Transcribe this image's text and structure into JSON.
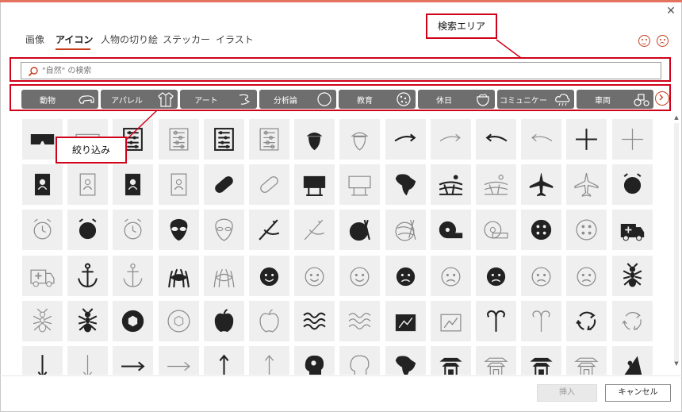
{
  "tabs": [
    {
      "label": "画像",
      "active": false
    },
    {
      "label": "アイコン",
      "active": true
    },
    {
      "label": "人物の切り絵",
      "active": false
    },
    {
      "label": "ステッカー",
      "active": false
    },
    {
      "label": "イラスト",
      "active": false
    }
  ],
  "search": {
    "placeholder": "\"自然\" の検索",
    "value": ""
  },
  "filters": [
    {
      "label": "動物",
      "icon": "bison-icon"
    },
    {
      "label": "アパレル",
      "icon": "jacket-icon"
    },
    {
      "label": "アート",
      "icon": "swirl-icon"
    },
    {
      "label": "分析論",
      "icon": "circle-icon"
    },
    {
      "label": "教育",
      "icon": "cookie-icon"
    },
    {
      "label": "休日",
      "icon": "cauldron-icon"
    },
    {
      "label": "コミュニケー",
      "icon": "cloud-icon"
    },
    {
      "label": "車両",
      "icon": "tractor-icon"
    }
  ],
  "callouts": {
    "search_area": "検索エリア",
    "filter": "絞り込み"
  },
  "icon_rows": [
    [
      "3d-glasses-icon",
      "3d-glasses-outline-icon",
      "abacus-icon",
      "abacus-outline-icon",
      "abacus-icon",
      "abacus-outline-icon",
      "acorn-icon",
      "acorn-outline-icon",
      "arrow-turn-right-icon",
      "arrow-turn-right-outline-icon",
      "arrow-turn-left-icon",
      "arrow-turn-left-outline-icon",
      "plus-icon",
      "plus-outline-icon"
    ],
    [
      "address-book-icon",
      "address-book-outline-icon",
      "address-book-icon",
      "address-book-outline-icon",
      "bandage-icon",
      "bandage-outline-icon",
      "billboard-icon",
      "billboard-outline-icon",
      "africa-icon",
      "farm-landscape-icon",
      "farm-landscape-outline-icon",
      "airplane-icon",
      "airplane-outline-icon",
      "alarm-clock-icon"
    ],
    [
      "alarm-clock-outline-icon",
      "alarm-ringing-icon",
      "alarm-ringing-outline-icon",
      "alien-icon",
      "alien-outline-icon",
      "needle-icon",
      "needle-outline-icon",
      "yarn-icon",
      "yarn-outline-icon",
      "measuring-tape-icon",
      "measuring-tape-outline-icon",
      "button-icon",
      "button-outline-icon",
      "ambulance-icon"
    ],
    [
      "ambulance-outline-icon",
      "anchor-icon",
      "anchor-outline-icon",
      "anemone-fish-icon",
      "anemone-fish-outline-icon",
      "angel-face-icon",
      "angel-face-outline-icon",
      "angel-face-outline-icon",
      "angry-face-icon",
      "angry-face-outline-icon",
      "angry-face-icon",
      "angry-face-outline-icon",
      "angry-face-outline-icon",
      "ant-icon"
    ],
    [
      "ant-outline-icon",
      "antarctica-icon",
      "aperture-icon",
      "aperture-outline-icon",
      "apple-icon",
      "apple-outline-icon",
      "waves-icon",
      "waves-outline-icon",
      "architect-icon",
      "architect-outline-icon",
      "aries-icon",
      "aries-outline-icon",
      "recycle-icon",
      "recycle-outline-icon"
    ],
    [
      "arrow-down-icon",
      "arrow-down-outline-icon",
      "arrow-right-icon",
      "arrow-right-outline-icon",
      "arrow-up-icon",
      "arrow-up-outline-icon",
      "head-gears-icon",
      "head-gears-outline-icon",
      "asia-icon",
      "pagoda-icon",
      "pagoda-outline-icon",
      "shrine-icon",
      "shrine-outline-icon",
      "climber-icon"
    ]
  ],
  "footer": {
    "insert": "挿入",
    "cancel": "キャンセル"
  }
}
